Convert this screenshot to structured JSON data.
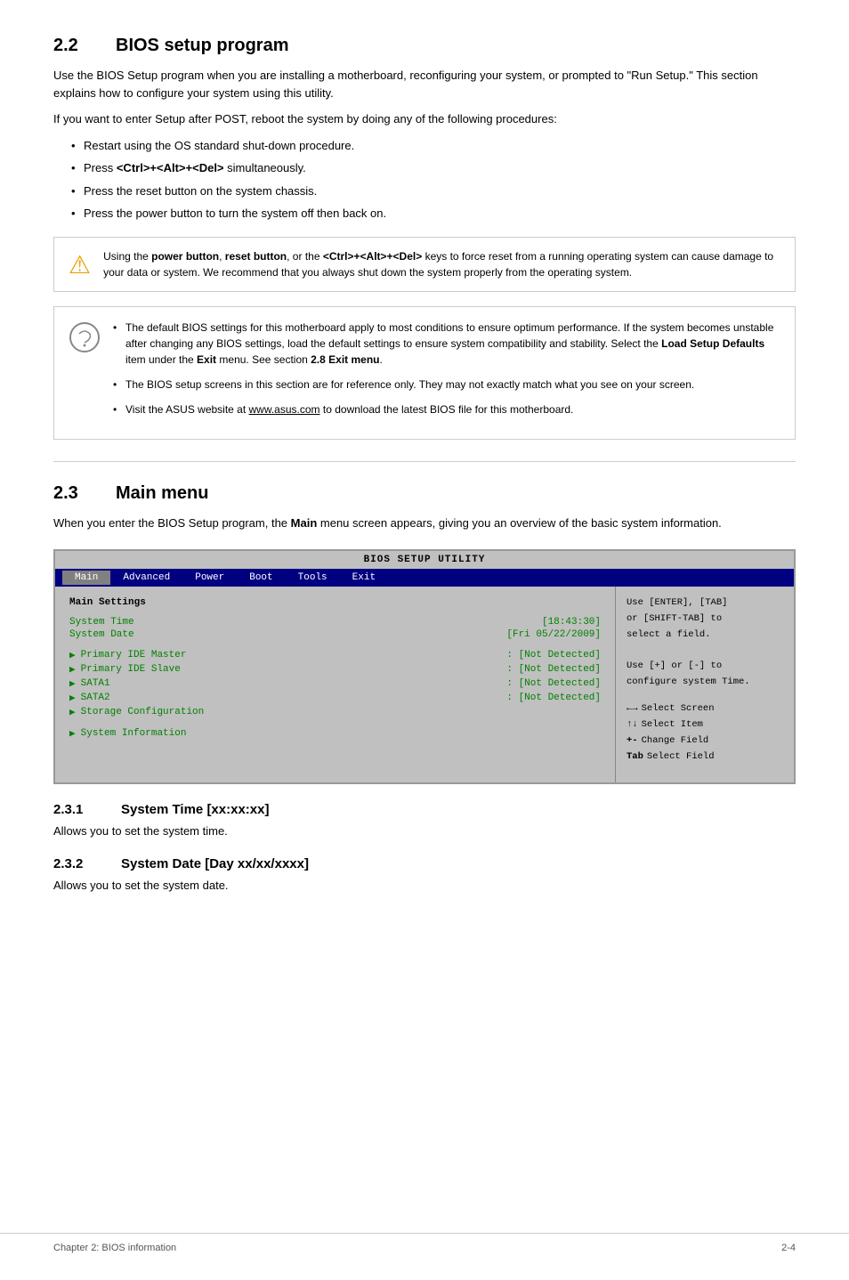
{
  "section22": {
    "number": "2.2",
    "title": "BIOS setup program",
    "intro1": "Use the BIOS Setup program when you are installing a motherboard, reconfiguring your system, or prompted to \"Run Setup.\" This section explains how to configure your system using this utility.",
    "intro2": "If you want to enter Setup after POST, reboot the system by doing any of the following procedures:",
    "bullets": [
      "Restart using the OS standard shut-down procedure.",
      "Press <Ctrl>+<Alt>+<Del> simultaneously.",
      "Press the reset button on the system chassis.",
      "Press the power button to turn the system off then back on."
    ],
    "warning_text": "Using the power button, reset button, or the <Ctrl>+<Alt>+<Del> keys to force reset from a running operating system can cause damage to your data or system. We recommend that you always shut down the system properly from the operating system.",
    "notes": [
      "The default BIOS settings for this motherboard apply to most conditions to ensure optimum performance. If the system becomes unstable after changing any BIOS settings, load the default settings to ensure system compatibility and stability. Select the Load Setup Defaults item under the Exit menu. See section 2.8 Exit menu.",
      "The BIOS setup screens in this section are for reference only. They may not exactly match what you see on your screen.",
      "Visit the ASUS website at www.asus.com to download the latest BIOS file for this motherboard."
    ]
  },
  "section23": {
    "number": "2.3",
    "title": "Main menu",
    "intro": "When you enter the BIOS Setup program, the Main menu screen appears, giving you an overview of the basic system information.",
    "bios": {
      "title": "BIOS SETUP UTILITY",
      "menu_items": [
        "Main",
        "Advanced",
        "Power",
        "Boot",
        "Tools",
        "Exit"
      ],
      "active_menu": "Main",
      "section_label": "Main Settings",
      "fields": [
        {
          "label": "System Time",
          "value": "[18:43:30]"
        },
        {
          "label": "System Date",
          "value": "[Fri 05/22/2009]"
        }
      ],
      "submenus": [
        {
          "label": "Primary IDE Master",
          "value": ": [Not Detected]"
        },
        {
          "label": "Primary IDE Slave",
          "value": ": [Not Detected]"
        },
        {
          "label": "SATA1",
          "value": ": [Not Detected]"
        },
        {
          "label": "SATA2",
          "value": ": [Not Detected]"
        },
        {
          "label": "Storage Configuration",
          "value": ""
        },
        {
          "label": "System Information",
          "value": ""
        }
      ],
      "help1": "Use [ENTER], [TAB]\nor [SHIFT-TAB] to\nselect a field.",
      "help2": "Use [+] or [-] to\nconfigure system Time.",
      "keys": [
        {
          "sym": "←→",
          "desc": "Select Screen"
        },
        {
          "sym": "↑↓",
          "desc": "Select Item"
        },
        {
          "sym": "+-",
          "desc": "Change Field"
        },
        {
          "sym": "Tab",
          "desc": "Select Field"
        }
      ]
    }
  },
  "section231": {
    "number": "2.3.1",
    "title": "System Time [xx:xx:xx]",
    "desc": "Allows you to set the system time."
  },
  "section232": {
    "number": "2.3.2",
    "title": "System Date [Day xx/xx/xxxx]",
    "desc": "Allows you to set the system date."
  },
  "footer": {
    "left": "Chapter 2: BIOS information",
    "right": "2-4"
  }
}
